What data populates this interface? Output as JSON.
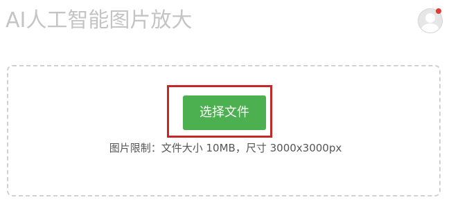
{
  "header": {
    "title": "AI人工智能图片放大",
    "avatar_icon": "user-avatar-icon",
    "notification_color": "#e53935"
  },
  "upload": {
    "button_label": "选择文件",
    "button_color": "#4caf50",
    "highlight_color": "#c62828",
    "limit_text": "图片限制：文件大小 10MB，尺寸 3000x3000px"
  }
}
